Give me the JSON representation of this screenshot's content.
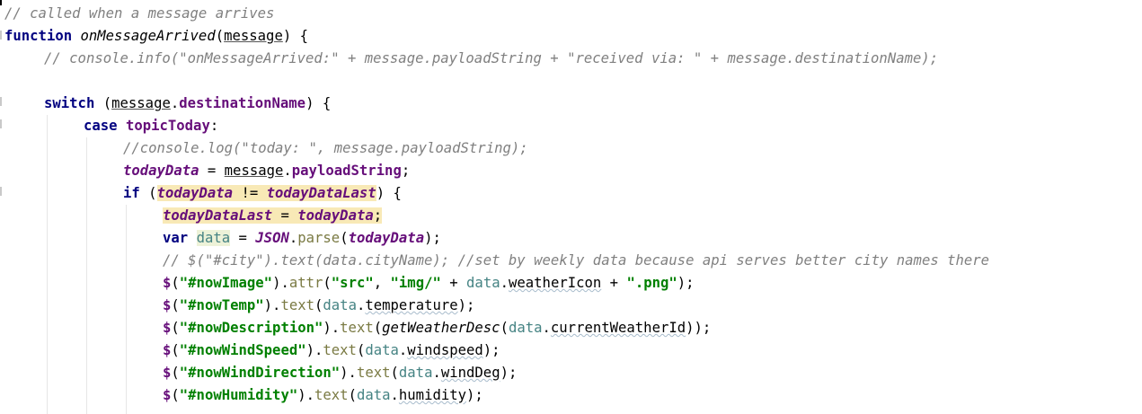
{
  "code": {
    "l1": {
      "comment": "// called when a message arrives"
    },
    "l2": {
      "kw": "function",
      "name": "onMessageArrived",
      "open": "(",
      "param": "message",
      "close": ") {"
    },
    "l3": {
      "comment": "// console.info(\"onMessageArrived:\" + message.payloadString + \"received via: \" + message.destinationName);"
    },
    "l5": {
      "kw": "switch",
      "p1": " (",
      "obj": "message",
      "dot": ".",
      "prop": "destinationName",
      "p2": ") {"
    },
    "l6": {
      "kw": "case",
      "sp": " ",
      "const": "topicToday",
      "colon": ":"
    },
    "l7": {
      "comment": "//console.log(\"today: \", message.payloadString);"
    },
    "l8": {
      "var": "todayData",
      "eq": " = ",
      "obj": "message",
      "dot": ".",
      "prop": "payloadString",
      "semi": ";"
    },
    "l9": {
      "kw": "if",
      "p1": " (",
      "a": "todayData",
      "op": " != ",
      "b": "todayDataLast",
      "p2": ") {"
    },
    "l10": {
      "a": "todayDataLast",
      "eq": " = ",
      "b": "todayData",
      "semi": ";"
    },
    "l11": {
      "kw": "var",
      "sp": " ",
      "v": "data",
      "eq": " = ",
      "json": "JSON",
      "dot": ".",
      "fn": "parse",
      "open": "(",
      "arg": "todayData",
      "close": ");"
    },
    "l12": {
      "comment": "// $(\"#city\").text(data.cityName); //set by weekly data because api serves better city names there"
    },
    "l13": {
      "dollar": "$",
      "open": "(",
      "sel": "\"#nowImage\"",
      "close": ").",
      "fn": "attr",
      "p1": "(",
      "s1": "\"src\"",
      "c": ", ",
      "s2": "\"img/\"",
      "plus1": " + ",
      "v": "data",
      "dot": ".",
      "prop": "weatherIcon",
      "plus2": " + ",
      "s3": "\".png\"",
      "end": ");"
    },
    "l14": {
      "dollar": "$",
      "open": "(",
      "sel": "\"#nowTemp\"",
      "close": ").",
      "fn": "text",
      "p1": "(",
      "v": "data",
      "dot": ".",
      "prop": "temperature",
      "end": ");"
    },
    "l15": {
      "dollar": "$",
      "open": "(",
      "sel": "\"#nowDescription\"",
      "close": ").",
      "fn": "text",
      "p1": "(",
      "call": "getWeatherDesc",
      "p2": "(",
      "v": "data",
      "dot": ".",
      "prop": "currentWeatherId",
      "end": "));"
    },
    "l16": {
      "dollar": "$",
      "open": "(",
      "sel": "\"#nowWindSpeed\"",
      "close": ").",
      "fn": "text",
      "p1": "(",
      "v": "data",
      "dot": ".",
      "prop": "windspeed",
      "end": ");"
    },
    "l17": {
      "dollar": "$",
      "open": "(",
      "sel": "\"#nowWindDirection\"",
      "close": ").",
      "fn": "text",
      "p1": "(",
      "v": "data",
      "dot": ".",
      "prop": "windDeg",
      "end": ");"
    },
    "l18": {
      "dollar": "$",
      "open": "(",
      "sel": "\"#nowHumidity\"",
      "close": ").",
      "fn": "text",
      "p1": "(",
      "v": "data",
      "dot": ".",
      "prop": "humidity",
      "end": ");"
    }
  },
  "colors": {
    "keyword": "#000080",
    "comment": "#808080",
    "string": "#008000",
    "global_var": "#660e7a",
    "local_var": "#458383",
    "identifier_highlight": "#f8e9b6"
  }
}
